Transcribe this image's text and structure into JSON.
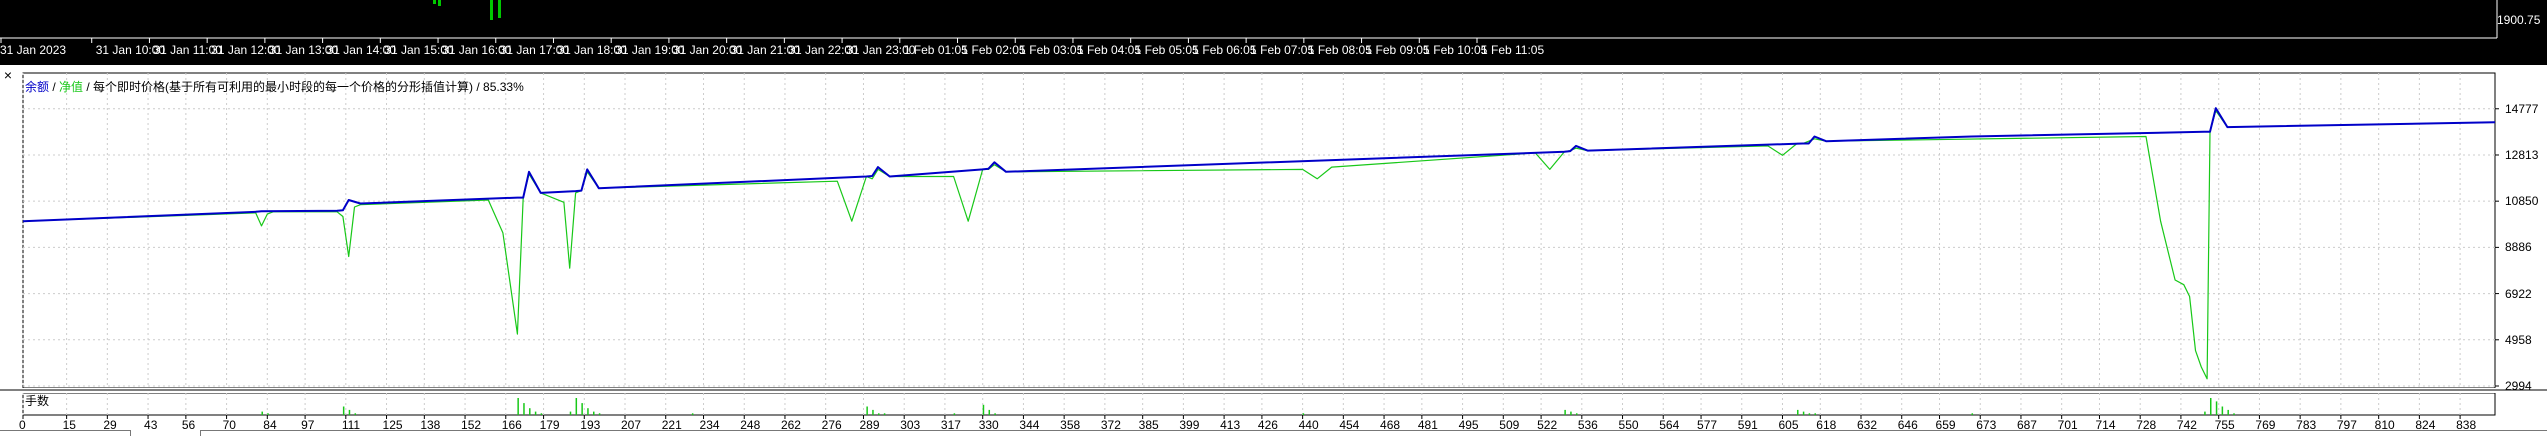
{
  "top_chart": {
    "time_labels": [
      "31 Jan 2023",
      "31 Jan 10:00",
      "31 Jan 11:00",
      "31 Jan 12:00",
      "31 Jan 13:00",
      "31 Jan 14:00",
      "31 Jan 15:00",
      "31 Jan 16:00",
      "31 Jan 17:00",
      "31 Jan 18:00",
      "31 Jan 19:00",
      "31 Jan 20:00",
      "31 Jan 21:00",
      "31 Jan 22:00",
      "31 Jan 23:00",
      "1 Feb 01:05",
      "1 Feb 02:05",
      "1 Feb 03:05",
      "1 Feb 04:05",
      "1 Feb 05:05",
      "1 Feb 06:05",
      "1 Feb 07:05",
      "1 Feb 08:05",
      "1 Feb 09:05",
      "1 Feb 10:05",
      "1 Feb 11:05"
    ],
    "price_label": "1900.75"
  },
  "tester": {
    "close_symbol": "×",
    "legend": {
      "balance": "余额",
      "sep1": " / ",
      "equity": "净值",
      "rest": " / 每个即时价格(基于所有可利用的最小时段的每一个价格的分形插值计算) / 85.33%"
    },
    "lots_label": "手数",
    "colors": {
      "balance": "#0000c8",
      "equity": "#18c818",
      "lots": "#18c818"
    }
  },
  "chart_data": [
    {
      "type": "line",
      "title": "",
      "xlabel": "",
      "ylabel": "",
      "ylim": [
        2994,
        16000
      ],
      "xlim": [
        0,
        850
      ],
      "y_ticks": [
        14777,
        12813,
        10850,
        8886,
        6922,
        4958,
        2994
      ],
      "x_ticks": [
        0,
        15,
        29,
        43,
        56,
        70,
        84,
        97,
        111,
        125,
        138,
        152,
        166,
        179,
        193,
        207,
        221,
        234,
        248,
        262,
        276,
        289,
        303,
        317,
        330,
        344,
        358,
        372,
        385,
        399,
        413,
        426,
        440,
        454,
        468,
        481,
        495,
        509,
        522,
        536,
        550,
        564,
        577,
        591,
        605,
        618,
        632,
        646,
        659,
        673,
        687,
        701,
        714,
        728,
        742,
        755,
        769,
        783,
        797,
        810,
        824,
        838
      ],
      "series": [
        {
          "name": "余额",
          "x": [
            0,
            80,
            82,
            108,
            110,
            112,
            116,
            170,
            172,
            174,
            178,
            190,
            192,
            194,
            198,
            290,
            292,
            294,
            298,
            330,
            332,
            334,
            338,
            530,
            532,
            534,
            538,
            612,
            614,
            616,
            620,
            670,
            750,
            752,
            754,
            758,
            850
          ],
          "y": [
            10000,
            10400,
            10420,
            10440,
            10460,
            10900,
            10750,
            11000,
            11000,
            12100,
            11200,
            11280,
            11300,
            12200,
            11400,
            11900,
            11920,
            12300,
            11900,
            12200,
            12230,
            12500,
            12100,
            12950,
            12980,
            13200,
            13000,
            13300,
            13300,
            13600,
            13400,
            13600,
            13800,
            13800,
            14800,
            14000,
            14200
          ]
        },
        {
          "name": "净值",
          "x": [
            0,
            80,
            82,
            84,
            86,
            108,
            110,
            112,
            114,
            116,
            160,
            165,
            170,
            172,
            174,
            178,
            186,
            188,
            190,
            192,
            194,
            198,
            280,
            285,
            290,
            292,
            294,
            298,
            320,
            325,
            330,
            332,
            334,
            338,
            440,
            445,
            450,
            520,
            525,
            530,
            532,
            534,
            538,
            600,
            605,
            610,
            612,
            614,
            616,
            620,
            730,
            735,
            740,
            743,
            745,
            747,
            749,
            751,
            752,
            754,
            758,
            850
          ],
          "y": [
            10000,
            10350,
            9800,
            10300,
            10400,
            10400,
            10200,
            8500,
            10600,
            10700,
            10900,
            9500,
            5200,
            11000,
            12000,
            11200,
            10800,
            8000,
            11200,
            11300,
            12100,
            11400,
            11700,
            10000,
            11900,
            11800,
            12200,
            11900,
            11900,
            10000,
            12200,
            12200,
            12400,
            12100,
            12200,
            11800,
            12300,
            12900,
            12200,
            12950,
            13000,
            13100,
            13000,
            13200,
            12800,
            13300,
            13300,
            13400,
            13500,
            13400,
            13600,
            10000,
            7500,
            7300,
            6800,
            4500,
            3800,
            3300,
            13800,
            14700,
            14000,
            14200
          ]
        }
      ]
    },
    {
      "type": "bar",
      "title": "",
      "xlabel": "",
      "ylabel": "",
      "xlim": [
        0,
        850
      ],
      "ylim": [
        0,
        10
      ],
      "series": [
        {
          "name": "手数",
          "x": [
            82,
            84,
            110,
            112,
            114,
            170,
            172,
            174,
            176,
            178,
            188,
            190,
            192,
            194,
            196,
            198,
            230,
            290,
            292,
            294,
            296,
            320,
            330,
            332,
            334,
            440,
            530,
            532,
            534,
            610,
            612,
            614,
            616,
            670,
            750,
            752,
            754,
            756,
            758,
            760
          ],
          "values": [
            2,
            1,
            5,
            3,
            1,
            10,
            7,
            4,
            2,
            1,
            2,
            10,
            7,
            4,
            2,
            1,
            1,
            5,
            3,
            1,
            1,
            1,
            6,
            3,
            1,
            1,
            3,
            2,
            1,
            3,
            2,
            1,
            1,
            1,
            2,
            10,
            8,
            5,
            3,
            1
          ]
        }
      ]
    }
  ]
}
